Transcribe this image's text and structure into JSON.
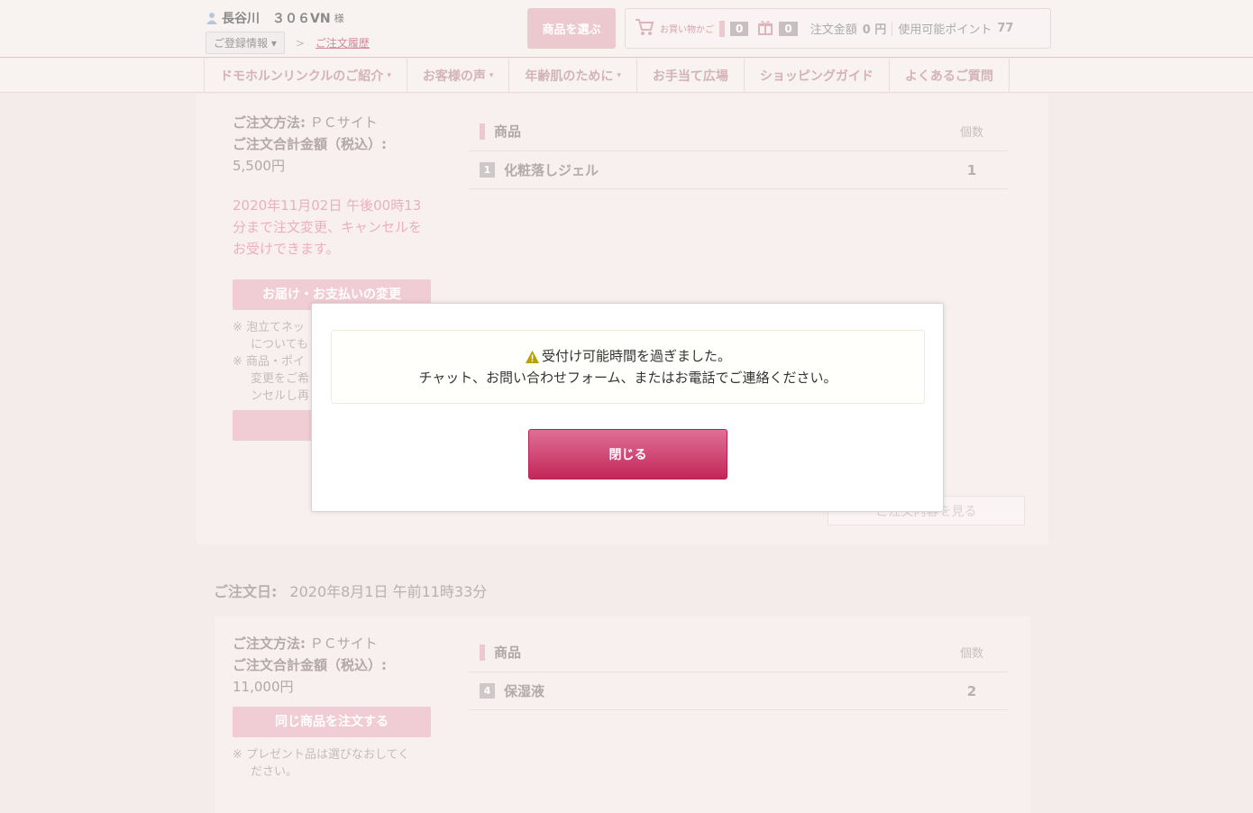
{
  "header": {
    "user_name": "長谷川　３０６VN",
    "user_suffix": "様",
    "registration_label": "ご登録情報 ▾",
    "crumb_sep": ">",
    "history_link": "ご注文履歴",
    "select_button": "商品を選ぶ",
    "cart_label": "お買い物かご",
    "cart_count": "0",
    "gift_count": "0",
    "order_amount_label": "注文金額",
    "order_amount_value": "0 円",
    "points_label": "使用可能ポイント",
    "points_value": "77"
  },
  "nav": {
    "items": [
      {
        "label": "ドモホルンリンクルのご紹介",
        "caret": "▾"
      },
      {
        "label": "お客様の声",
        "caret": "▾"
      },
      {
        "label": "年齢肌のために",
        "caret": "▾"
      },
      {
        "label": "お手当て広場",
        "caret": ""
      },
      {
        "label": "ショッピングガイド",
        "caret": ""
      },
      {
        "label": "よくあるご質問",
        "caret": ""
      }
    ]
  },
  "order1": {
    "method_label": "ご注文方法:",
    "method_value": "ＰＣサイト",
    "total_label": "ご注文合計金額（税込）:",
    "total_value": "5,500円",
    "deadline": " 2020年11月02日 午後00時13分まで注文変更、キャンセルをお受けできます。",
    "change_button": "お届け・お支払いの変更",
    "note1": "※ 泡立てネッ",
    "note1b": "についても",
    "note2": "※ 商品・ポイ",
    "note2b": "変更をご希",
    "note2c": "ンセルし再",
    "cancel_button": "ご注文",
    "items_header": "商品",
    "qty_header": "個数",
    "items": [
      {
        "num": "1",
        "name": "化粧落しジェル",
        "qty": "1"
      }
    ],
    "view_detail": "ご注文内容を見る"
  },
  "order2": {
    "date_label": "ご注文日:",
    "date_value": "2020年8月1日 午前11時33分",
    "method_label": "ご注文方法:",
    "method_value": "ＰＣサイト",
    "total_label": "ご注文合計金額（税込）:",
    "total_value": "11,000円",
    "reorder_button": "同じ商品を注文する",
    "note1": "※ プレゼント品は選びなおしてく",
    "note1b": "ださい。",
    "items_header": "商品",
    "qty_header": "個数",
    "items": [
      {
        "num": "4",
        "name": "保湿液",
        "qty": "2"
      }
    ]
  },
  "modal": {
    "message_line1": "受付け可能時間を過ぎました。",
    "message_line2": "チャット、お問い合わせフォーム、またはお電話でご連絡ください。",
    "close_label": "閉じる"
  },
  "colors": {
    "accent": "#c3275a",
    "warning": "#b8a000"
  }
}
